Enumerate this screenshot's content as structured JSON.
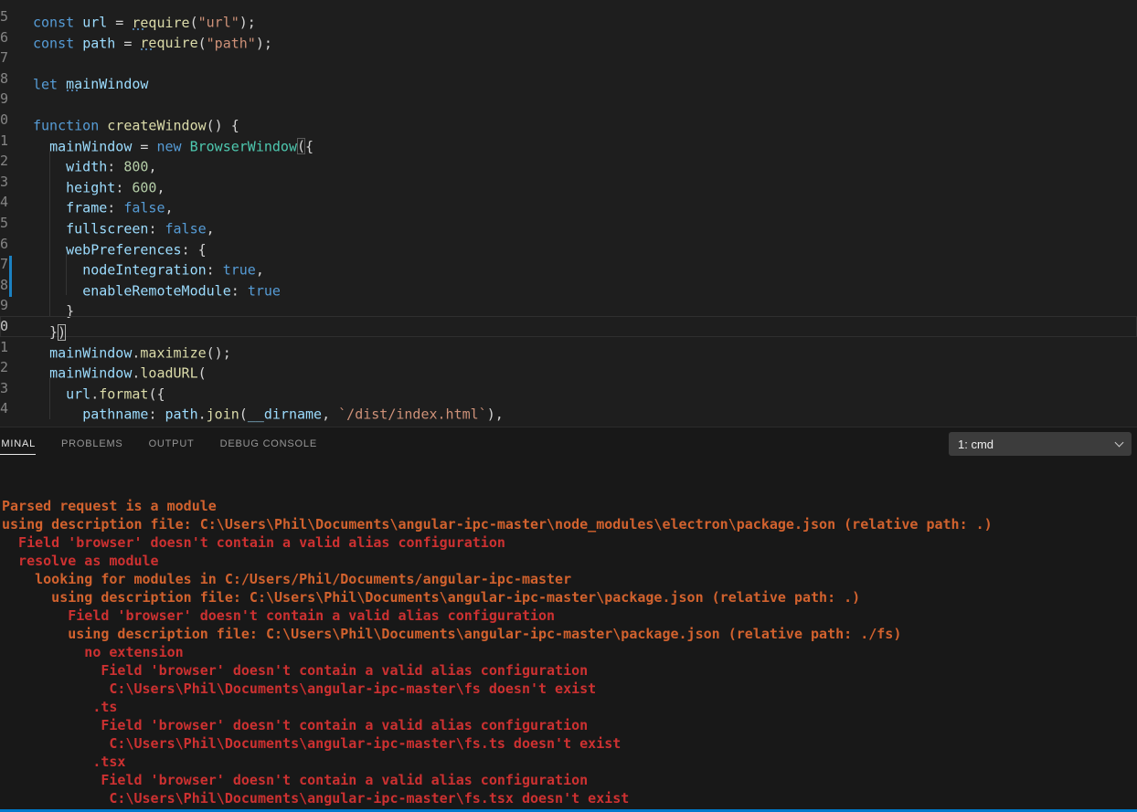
{
  "theme": {
    "editor_bg": "#1e1e1e",
    "panel_bg": "#181818",
    "accent_blue": "#007acc",
    "modified_indicator": "#1b81c2",
    "terminal_red": "#cd3131",
    "terminal_orange": "#d2622e"
  },
  "editor": {
    "lines": [
      {
        "num": "5",
        "tokens": [
          {
            "t": "const ",
            "c": "kw"
          },
          {
            "t": "url",
            "c": "var"
          },
          {
            "t": " = ",
            "c": "pun"
          },
          {
            "t": "require",
            "c": "fn",
            "hint": true
          },
          {
            "t": "(",
            "c": "pun"
          },
          {
            "t": "\"url\"",
            "c": "str"
          },
          {
            "t": ");",
            "c": "pun"
          }
        ]
      },
      {
        "num": "6",
        "tokens": [
          {
            "t": "const ",
            "c": "kw"
          },
          {
            "t": "path",
            "c": "var"
          },
          {
            "t": " = ",
            "c": "pun"
          },
          {
            "t": "require",
            "c": "fn",
            "hint": true
          },
          {
            "t": "(",
            "c": "pun"
          },
          {
            "t": "\"path\"",
            "c": "str"
          },
          {
            "t": ");",
            "c": "pun"
          }
        ]
      },
      {
        "num": "7",
        "tokens": []
      },
      {
        "num": "8",
        "tokens": [
          {
            "t": "let ",
            "c": "kw"
          },
          {
            "t": "mainWindow",
            "c": "var",
            "hint": true
          }
        ]
      },
      {
        "num": "9",
        "tokens": []
      },
      {
        "num": "0",
        "tokens": [
          {
            "t": "function ",
            "c": "kw"
          },
          {
            "t": "createWindow",
            "c": "fn"
          },
          {
            "t": "() {",
            "c": "pun"
          }
        ]
      },
      {
        "num": "1",
        "tokens": [
          {
            "t": "  ",
            "c": "pun"
          },
          {
            "t": "mainWindow",
            "c": "var"
          },
          {
            "t": " = ",
            "c": "pun"
          },
          {
            "t": "new ",
            "c": "kw"
          },
          {
            "t": "BrowserWindow",
            "c": "cls"
          },
          {
            "t": "(",
            "c": "pun",
            "box": true
          },
          {
            "t": "{",
            "c": "pun"
          }
        ]
      },
      {
        "num": "2",
        "tokens": [
          {
            "t": "    ",
            "c": "pun"
          },
          {
            "t": "width",
            "c": "var"
          },
          {
            "t": ": ",
            "c": "pun"
          },
          {
            "t": "800",
            "c": "num"
          },
          {
            "t": ",",
            "c": "pun"
          }
        ]
      },
      {
        "num": "3",
        "tokens": [
          {
            "t": "    ",
            "c": "pun"
          },
          {
            "t": "height",
            "c": "var"
          },
          {
            "t": ": ",
            "c": "pun"
          },
          {
            "t": "600",
            "c": "num"
          },
          {
            "t": ",",
            "c": "pun"
          }
        ]
      },
      {
        "num": "4",
        "tokens": [
          {
            "t": "    ",
            "c": "pun"
          },
          {
            "t": "frame",
            "c": "var"
          },
          {
            "t": ": ",
            "c": "pun"
          },
          {
            "t": "false",
            "c": "kw"
          },
          {
            "t": ",",
            "c": "pun"
          }
        ]
      },
      {
        "num": "5",
        "tokens": [
          {
            "t": "    ",
            "c": "pun"
          },
          {
            "t": "fullscreen",
            "c": "var"
          },
          {
            "t": ": ",
            "c": "pun"
          },
          {
            "t": "false",
            "c": "kw"
          },
          {
            "t": ",",
            "c": "pun"
          }
        ]
      },
      {
        "num": "6",
        "tokens": [
          {
            "t": "    ",
            "c": "pun"
          },
          {
            "t": "webPreferences",
            "c": "var"
          },
          {
            "t": ": {",
            "c": "pun"
          }
        ]
      },
      {
        "num": "7",
        "tokens": [
          {
            "t": "      ",
            "c": "pun"
          },
          {
            "t": "nodeIntegration",
            "c": "var"
          },
          {
            "t": ": ",
            "c": "pun"
          },
          {
            "t": "true",
            "c": "kw"
          },
          {
            "t": ",",
            "c": "pun"
          }
        ]
      },
      {
        "num": "8",
        "tokens": [
          {
            "t": "      ",
            "c": "pun"
          },
          {
            "t": "enableRemoteModule",
            "c": "var"
          },
          {
            "t": ": ",
            "c": "pun"
          },
          {
            "t": "true",
            "c": "kw"
          }
        ]
      },
      {
        "num": "9",
        "tokens": [
          {
            "t": "    }",
            "c": "pun"
          }
        ]
      },
      {
        "num": "0",
        "current": true,
        "tokens": [
          {
            "t": "  }",
            "c": "pun"
          },
          {
            "t": ")",
            "c": "pun",
            "cursor": true
          }
        ]
      },
      {
        "num": "1",
        "tokens": [
          {
            "t": "  ",
            "c": "pun"
          },
          {
            "t": "mainWindow",
            "c": "var"
          },
          {
            "t": ".",
            "c": "pun"
          },
          {
            "t": "maximize",
            "c": "fn"
          },
          {
            "t": "();",
            "c": "pun"
          }
        ]
      },
      {
        "num": "2",
        "tokens": [
          {
            "t": "  ",
            "c": "pun"
          },
          {
            "t": "mainWindow",
            "c": "var"
          },
          {
            "t": ".",
            "c": "pun"
          },
          {
            "t": "loadURL",
            "c": "fn"
          },
          {
            "t": "(",
            "c": "pun"
          }
        ]
      },
      {
        "num": "3",
        "tokens": [
          {
            "t": "    ",
            "c": "pun"
          },
          {
            "t": "url",
            "c": "var"
          },
          {
            "t": ".",
            "c": "pun"
          },
          {
            "t": "format",
            "c": "fn"
          },
          {
            "t": "({",
            "c": "pun"
          }
        ]
      },
      {
        "num": "4",
        "tokens": [
          {
            "t": "      ",
            "c": "pun"
          },
          {
            "t": "pathname",
            "c": "var"
          },
          {
            "t": ": ",
            "c": "pun"
          },
          {
            "t": "path",
            "c": "var"
          },
          {
            "t": ".",
            "c": "pun"
          },
          {
            "t": "join",
            "c": "fn"
          },
          {
            "t": "(",
            "c": "pun"
          },
          {
            "t": "__dirname",
            "c": "var"
          },
          {
            "t": ", ",
            "c": "pun"
          },
          {
            "t": "`/dist/index.html`",
            "c": "str"
          },
          {
            "t": "),",
            "c": "pun"
          }
        ]
      }
    ]
  },
  "panel": {
    "tabs": [
      {
        "label": "TERMINAL",
        "active": true
      },
      {
        "label": "PROBLEMS",
        "active": false
      },
      {
        "label": "OUTPUT",
        "active": false
      },
      {
        "label": "DEBUG CONSOLE",
        "active": false
      }
    ],
    "terminal_selector": {
      "value": "1: cmd"
    }
  },
  "terminal": {
    "lines": [
      {
        "text": "Parsed request is a module",
        "color": "orange"
      },
      {
        "text": "using description file: C:\\Users\\Phil\\Documents\\angular-ipc-master\\node_modules\\electron\\package.json (relative path: .)",
        "color": "orange"
      },
      {
        "text": "  Field 'browser' doesn't contain a valid alias configuration",
        "color": "red"
      },
      {
        "text": "  resolve as module",
        "color": "red"
      },
      {
        "text": "    looking for modules in C:/Users/Phil/Documents/angular-ipc-master",
        "color": "orange"
      },
      {
        "text": "      using description file: C:\\Users\\Phil\\Documents\\angular-ipc-master\\package.json (relative path: .)",
        "color": "orange"
      },
      {
        "text": "        Field 'browser' doesn't contain a valid alias configuration",
        "color": "red"
      },
      {
        "text": "        using description file: C:\\Users\\Phil\\Documents\\angular-ipc-master\\package.json (relative path: ./fs)",
        "color": "orange"
      },
      {
        "text": "          no extension",
        "color": "red"
      },
      {
        "text": "            Field 'browser' doesn't contain a valid alias configuration",
        "color": "red"
      },
      {
        "text": "             C:\\Users\\Phil\\Documents\\angular-ipc-master\\fs doesn't exist",
        "color": "red"
      },
      {
        "text": "           .ts",
        "color": "red"
      },
      {
        "text": "            Field 'browser' doesn't contain a valid alias configuration",
        "color": "red"
      },
      {
        "text": "             C:\\Users\\Phil\\Documents\\angular-ipc-master\\fs.ts doesn't exist",
        "color": "red"
      },
      {
        "text": "           .tsx",
        "color": "red"
      },
      {
        "text": "            Field 'browser' doesn't contain a valid alias configuration",
        "color": "red"
      },
      {
        "text": "             C:\\Users\\Phil\\Documents\\angular-ipc-master\\fs.tsx doesn't exist",
        "color": "red"
      }
    ]
  }
}
